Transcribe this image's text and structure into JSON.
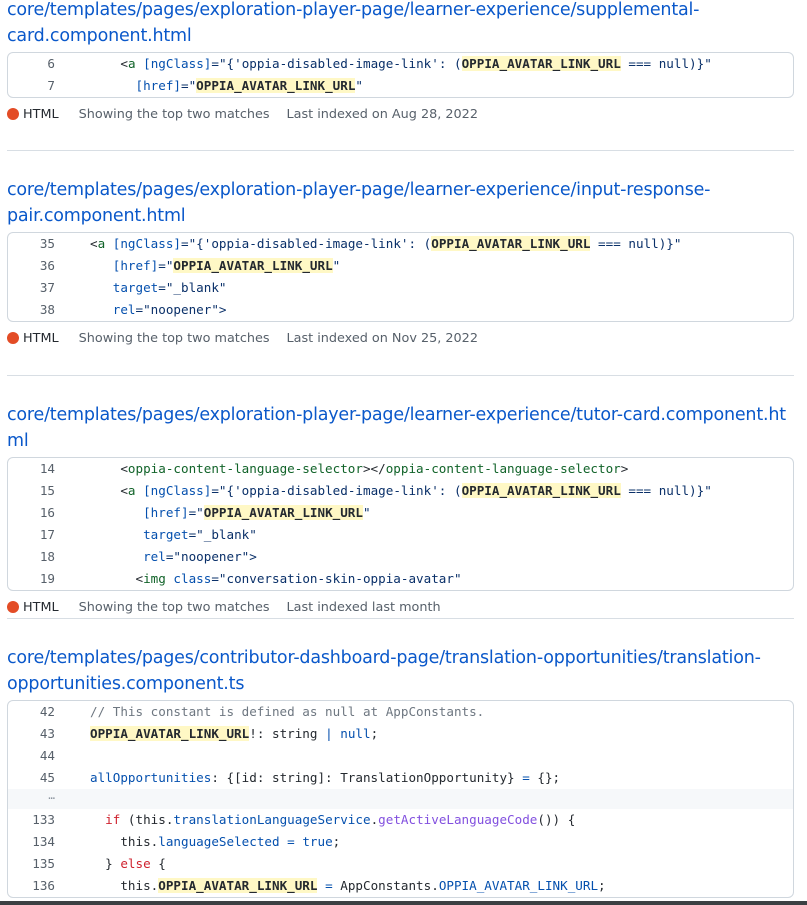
{
  "results": [
    {
      "file_line1": "core/templates/pages/exploration-player-page/learner-experience/supplemental-",
      "file_line2": "card.component.html",
      "lines": [
        {
          "num": "6",
          "tokens": [
            [
              "    ",
              "t-plain"
            ],
            [
              "<",
              "t-plain"
            ],
            [
              "a",
              "t-tag"
            ],
            [
              " [ngClass]",
              "t-attr"
            ],
            [
              "=\"{'oppia-disabled-image-link': (",
              "t-str"
            ],
            [
              "OPPIA_AVATAR_LINK_URL",
              "hl"
            ],
            [
              " === null)}\"",
              "t-str"
            ]
          ]
        },
        {
          "num": "7",
          "tokens": [
            [
              "      [href]",
              "t-attr"
            ],
            [
              "=\"",
              "t-str"
            ],
            [
              "OPPIA_AVATAR_LINK_URL",
              "hl"
            ],
            [
              "\"",
              "t-str"
            ]
          ]
        }
      ],
      "lang": "HTML",
      "matches": "Showing the top two matches",
      "indexed": "Last indexed on Aug 28, 2022"
    },
    {
      "file_line1": "core/templates/pages/exploration-player-page/learner-experience/input-response-",
      "file_line2": "pair.component.html",
      "lines": [
        {
          "num": "35",
          "tokens": [
            [
              "<",
              "t-plain"
            ],
            [
              "a",
              "t-tag"
            ],
            [
              " [ngClass]",
              "t-attr"
            ],
            [
              "=\"{'oppia-disabled-image-link': (",
              "t-str"
            ],
            [
              "OPPIA_AVATAR_LINK_URL",
              "hl"
            ],
            [
              " === null)}\"",
              "t-str"
            ]
          ]
        },
        {
          "num": "36",
          "tokens": [
            [
              "   [href]",
              "t-attr"
            ],
            [
              "=\"",
              "t-str"
            ],
            [
              "OPPIA_AVATAR_LINK_URL",
              "hl"
            ],
            [
              "\"",
              "t-str"
            ]
          ]
        },
        {
          "num": "37",
          "tokens": [
            [
              "   target",
              "t-attr"
            ],
            [
              "=\"_blank\"",
              "t-str"
            ]
          ]
        },
        {
          "num": "38",
          "tokens": [
            [
              "   rel",
              "t-attr"
            ],
            [
              "=\"noopener\">",
              "t-str"
            ]
          ]
        }
      ],
      "lang": "HTML",
      "matches": "Showing the top two matches",
      "indexed": "Last indexed on Nov 25, 2022"
    },
    {
      "file_line1": "core/templates/pages/exploration-player-page/learner-experience/tutor-card.component.html",
      "file_line2": "",
      "lines": [
        {
          "num": "14",
          "tokens": [
            [
              "    <",
              "t-plain"
            ],
            [
              "oppia-content-language-selector",
              "t-tag"
            ],
            [
              "></",
              "t-plain"
            ],
            [
              "oppia-content-language-selector",
              "t-tag"
            ],
            [
              ">",
              "t-plain"
            ]
          ]
        },
        {
          "num": "15",
          "tokens": [
            [
              "    <",
              "t-plain"
            ],
            [
              "a",
              "t-tag"
            ],
            [
              " [ngClass]",
              "t-attr"
            ],
            [
              "=\"{'oppia-disabled-image-link': (",
              "t-str"
            ],
            [
              "OPPIA_AVATAR_LINK_URL",
              "hl"
            ],
            [
              " === null)}\"",
              "t-str"
            ]
          ]
        },
        {
          "num": "16",
          "tokens": [
            [
              "       [href]",
              "t-attr"
            ],
            [
              "=\"",
              "t-str"
            ],
            [
              "OPPIA_AVATAR_LINK_URL",
              "hl"
            ],
            [
              "\"",
              "t-str"
            ]
          ]
        },
        {
          "num": "17",
          "tokens": [
            [
              "       target",
              "t-attr"
            ],
            [
              "=\"_blank\"",
              "t-str"
            ]
          ]
        },
        {
          "num": "18",
          "tokens": [
            [
              "       rel",
              "t-attr"
            ],
            [
              "=\"noopener\">",
              "t-str"
            ]
          ]
        },
        {
          "num": "19",
          "tokens": [
            [
              "      <",
              "t-plain"
            ],
            [
              "img",
              "t-tag"
            ],
            [
              " class",
              "t-attr"
            ],
            [
              "=\"conversation-skin-oppia-avatar\"",
              "t-str"
            ]
          ]
        }
      ],
      "lang": "HTML",
      "matches": "Showing the top two matches",
      "indexed": "Last indexed last month"
    },
    {
      "file_line1": "core/templates/pages/contributor-dashboard-page/translation-opportunities/translation-",
      "file_line2": "opportunities.component.ts",
      "lines": [
        {
          "num": "42",
          "tokens": [
            [
              "// This constant is defined as null at AppConstants.",
              "t-cmt"
            ]
          ]
        },
        {
          "num": "43",
          "tokens": [
            [
              "OPPIA_AVATAR_LINK_URL",
              "hl"
            ],
            [
              "!: string ",
              "t-plain"
            ],
            [
              "|",
              "t-op"
            ],
            [
              " ",
              "t-plain"
            ],
            [
              "null",
              "t-prop"
            ],
            [
              ";",
              "t-plain"
            ]
          ]
        },
        {
          "num": "44",
          "tokens": []
        },
        {
          "num": "45",
          "tokens": [
            [
              "allOpportunities",
              "t-prop"
            ],
            [
              ": {[id: string]: TranslationOpportunity} ",
              "t-plain"
            ],
            [
              "=",
              "t-op"
            ],
            [
              " {};",
              "t-plain"
            ]
          ]
        },
        {
          "num": "…",
          "sep": true,
          "tokens": []
        },
        {
          "num": "133",
          "tokens": [
            [
              "  ",
              "t-plain"
            ],
            [
              "if",
              "t-kw"
            ],
            [
              " (this.",
              "t-plain"
            ],
            [
              "translationLanguageService",
              "t-prop"
            ],
            [
              ".",
              "t-plain"
            ],
            [
              "getActiveLanguageCode",
              "t-fn"
            ],
            [
              "()) {",
              "t-plain"
            ]
          ]
        },
        {
          "num": "134",
          "tokens": [
            [
              "    this.",
              "t-plain"
            ],
            [
              "languageSelected",
              "t-prop"
            ],
            [
              " = ",
              "t-op"
            ],
            [
              "true",
              "t-prop"
            ],
            [
              ";",
              "t-plain"
            ]
          ]
        },
        {
          "num": "135",
          "tokens": [
            [
              "  } ",
              "t-plain"
            ],
            [
              "else",
              "t-kw"
            ],
            [
              " {",
              "t-plain"
            ]
          ]
        },
        {
          "num": "136",
          "tokens": [
            [
              "    this.",
              "t-plain"
            ],
            [
              "OPPIA_AVATAR_LINK_URL",
              "hl"
            ],
            [
              " = ",
              "t-op"
            ],
            [
              "AppConstants.",
              "t-plain"
            ],
            [
              "OPPIA_AVATAR_LINK_URL",
              "t-prop"
            ],
            [
              ";",
              "t-plain"
            ]
          ]
        }
      ],
      "lang": "",
      "matches": "",
      "indexed": ""
    }
  ]
}
